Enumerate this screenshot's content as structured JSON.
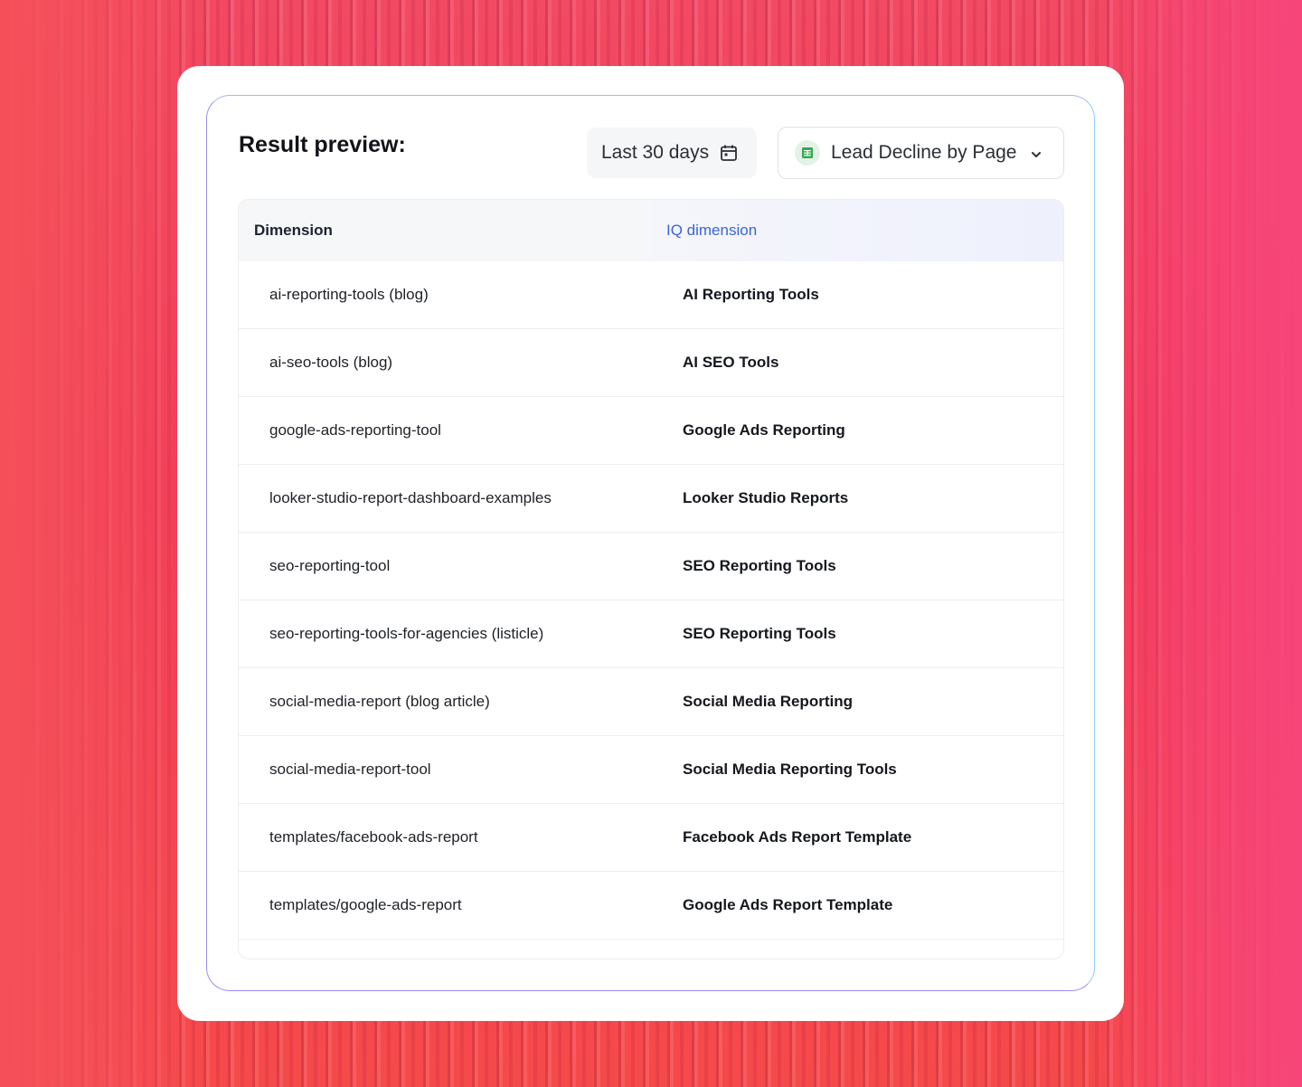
{
  "header": {
    "title": "Result preview:",
    "date_range": "Last 30 days",
    "report_name": "Lead Decline by Page"
  },
  "icons": {
    "date": "calendar-icon",
    "report": "google-sheets-icon",
    "dropdown": "chevron-down-icon"
  },
  "colors": {
    "accent": "#3a63d8",
    "sheets_green": "#34a853"
  },
  "table": {
    "columns": [
      "Dimension",
      "IQ dimension"
    ],
    "rows": [
      {
        "dimension": "ai-reporting-tools (blog)",
        "iq": "AI Reporting Tools"
      },
      {
        "dimension": "ai-seo-tools (blog)",
        "iq": "AI SEO Tools"
      },
      {
        "dimension": "google-ads-reporting-tool",
        "iq": "Google Ads Reporting"
      },
      {
        "dimension": "looker-studio-report-dashboard-examples",
        "iq": "Looker Studio Reports"
      },
      {
        "dimension": "seo-reporting-tool",
        "iq": "SEO Reporting Tools"
      },
      {
        "dimension": "seo-reporting-tools-for-agencies (listicle)",
        "iq": "SEO Reporting Tools"
      },
      {
        "dimension": "social-media-report (blog article)",
        "iq": "Social Media Reporting"
      },
      {
        "dimension": "social-media-report-tool",
        "iq": "Social Media Reporting Tools"
      },
      {
        "dimension": "templates/facebook-ads-report",
        "iq": "Facebook Ads Report Template"
      },
      {
        "dimension": "templates/google-ads-report",
        "iq": "Google Ads Report Template"
      }
    ]
  }
}
